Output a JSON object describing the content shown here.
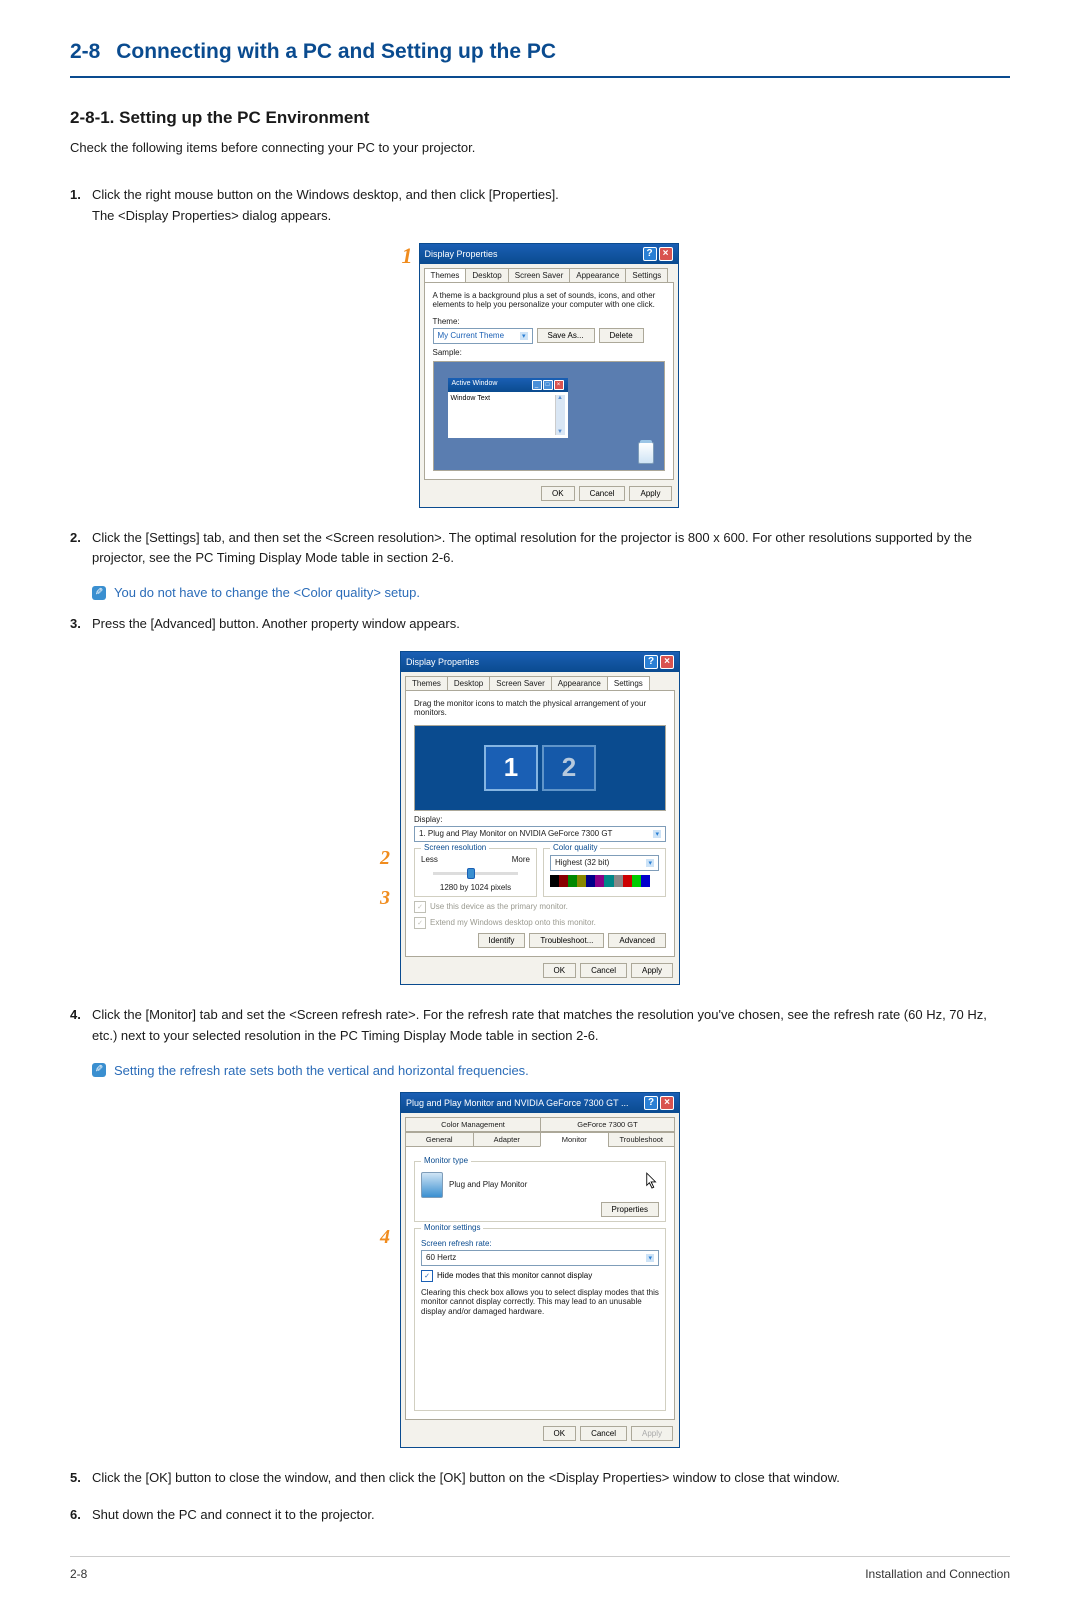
{
  "page": {
    "section_number": "2-8",
    "section_title": "Connecting with a PC and Setting up the PC",
    "subsection": "2-8-1. Setting up the PC Environment",
    "intro": "Check the following items before connecting your PC to your projector.",
    "footer_left": "2-8",
    "footer_right": "Installation and Connection"
  },
  "steps": {
    "s1a": "Click the right mouse button on the Windows desktop, and then click [Properties].",
    "s1b": "The <Display Properties> dialog appears.",
    "s2": "Click the [Settings] tab, and then set the <Screen resolution>. The optimal resolution for the projector is 800 x 600. For other resolutions supported by the projector, see the PC Timing Display Mode table in section 2-6.",
    "note2": "You do not have to change the <Color quality> setup.",
    "s3": "Press the [Advanced] button. Another property window appears.",
    "s4": "Click the [Monitor] tab and set the <Screen refresh rate>. For the refresh rate that matches the resolution you've chosen, see the refresh rate (60 Hz, 70 Hz, etc.) next to your selected resolution in the PC Timing Display Mode table in section 2-6.",
    "note4": "Setting the refresh rate sets both the vertical and horizontal frequencies.",
    "s5": "Click the [OK] button to close the window, and then click the [OK] button on the <Display Properties> window to close that window.",
    "s6": "Shut down the PC and connect it to the projector."
  },
  "dlg1": {
    "title": "Display Properties",
    "tabs": {
      "t1": "Themes",
      "t2": "Desktop",
      "t3": "Screen Saver",
      "t4": "Appearance",
      "t5": "Settings"
    },
    "themes_desc": "A theme is a background plus a set of sounds, icons, and other elements to help you personalize your computer with one click.",
    "theme_lbl": "Theme:",
    "theme_val": "My Current Theme",
    "save_as": "Save As...",
    "delete": "Delete",
    "sample_lbl": "Sample:",
    "active_win": "Active Window",
    "win_text": "Window Text",
    "ok": "OK",
    "cancel": "Cancel",
    "apply": "Apply"
  },
  "dlg2": {
    "title": "Display Properties",
    "instr": "Drag the monitor icons to match the physical arrangement of your monitors.",
    "display_lbl": "Display:",
    "display_val": "1. Plug and Play Monitor on NVIDIA GeForce 7300 GT",
    "res_title": "Screen resolution",
    "less": "Less",
    "more": "More",
    "res_val": "1280 by 1024 pixels",
    "cq_title": "Color quality",
    "cq_val": "Highest (32 bit)",
    "chk1": "Use this device as the primary monitor.",
    "chk2": "Extend my Windows desktop onto this monitor.",
    "identify": "Identify",
    "troubleshoot": "Troubleshoot...",
    "advanced": "Advanced",
    "ok": "OK",
    "cancel": "Cancel",
    "apply": "Apply"
  },
  "dlg3": {
    "title": "Plug and Play Monitor and NVIDIA GeForce 7300 GT ...",
    "tabs": {
      "t1": "Color Management",
      "t2": "GeForce 7300 GT",
      "t3": "General",
      "t4": "Adapter",
      "t5": "Monitor",
      "t6": "Troubleshoot"
    },
    "mt_title": "Monitor type",
    "mt_val": "Plug and Play Monitor",
    "properties": "Properties",
    "ms_title": "Monitor settings",
    "rr_lbl": "Screen refresh rate:",
    "rr_val": "60 Hertz",
    "hide_chk": "Hide modes that this monitor cannot display",
    "hide_desc": "Clearing this check box allows you to select display modes that this monitor cannot display correctly. This may lead to an unusable display and/or damaged hardware.",
    "ok": "OK",
    "cancel": "Cancel",
    "apply": "Apply"
  },
  "callouts": {
    "c1": "1",
    "c2": "2",
    "c3": "3",
    "c4": "4",
    "m1": "1",
    "m2": "2"
  }
}
